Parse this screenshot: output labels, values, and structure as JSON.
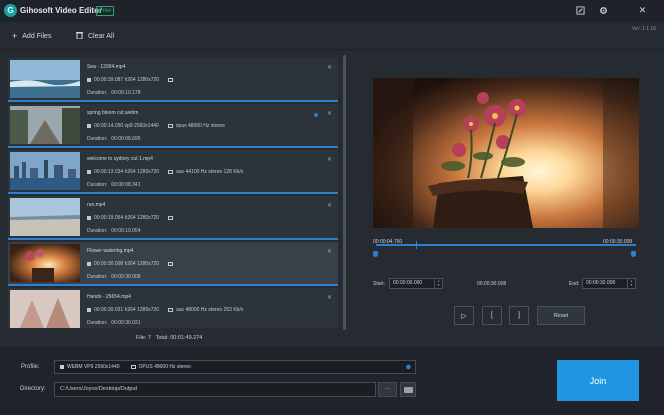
{
  "app": {
    "title": "Gihosoft Video Editor",
    "badge": "Free",
    "version": "Ver: 1.1.16"
  },
  "icons": {
    "logo": "logo-icon",
    "edit": "edit-icon",
    "settings": "gear-icon",
    "close": "close-icon"
  },
  "toolbar": {
    "add_files": "Add Files",
    "clear_all": "Clear All"
  },
  "files": [
    {
      "name": "Sea - 13394.mp4",
      "video": "00:00:39.087 h264 1280x720",
      "audio": "",
      "duration_label": "Duration:",
      "duration": "00:00:10.178"
    },
    {
      "name": "spring bloom cut.webm",
      "video": "00:00:14.050 vp9 2560x1440",
      "audio": "opus 48000 Hz stereo",
      "duration_label": "Duration:",
      "duration": "00:00:06.695"
    },
    {
      "name": "welcome to sydney cut 1.mp4",
      "video": "00:00:13.034 h264 1280x720",
      "audio": "aac 44100 Hz stereo  128 Kb/s",
      "duration_label": "Duration:",
      "duration": "00:00:08.341"
    },
    {
      "name": "run.mp4",
      "video": "00:00:19.054 h264 1280x720",
      "audio": "",
      "duration_label": "Duration:",
      "duration": "00:00:19.054"
    },
    {
      "name": "Flower watering.mp4",
      "video": "00:00:30.008 h264 1280x720",
      "audio": "",
      "duration_label": "Duration:",
      "duration": "00:00:30.008"
    },
    {
      "name": "Hands - 25654.mp4",
      "video": "00:00:30.031 h264 1280x720",
      "audio": "aac 48000 Hz stereo  253 Kb/s",
      "duration_label": "Duration:",
      "duration": "00:00:30.031"
    }
  ],
  "summary": {
    "files": "File: 7",
    "total": "Total: 00:01:49.274"
  },
  "preview": {
    "current_time": "00:00:04.760",
    "end_time": "00:00:30.008",
    "playhead_fraction": 0.155
  },
  "trim": {
    "start_label": "Start:",
    "start": "00:00:00.000",
    "mid": "00:00:30.008",
    "end_label": "End:",
    "end": "00:00:30.008"
  },
  "controls": {
    "play": "▷",
    "mark_in": "[",
    "mark_out": "]",
    "reset": "Reset"
  },
  "output": {
    "profile_label": "Profile:",
    "profile_video": "WEBM VP9 2560x1440",
    "profile_audio": "OPUS 48000 Hz stereo",
    "directory_label": "Directory:",
    "directory": "C:/Users/Joyce/Desktop/Output",
    "browse": "...",
    "join": "Join"
  }
}
